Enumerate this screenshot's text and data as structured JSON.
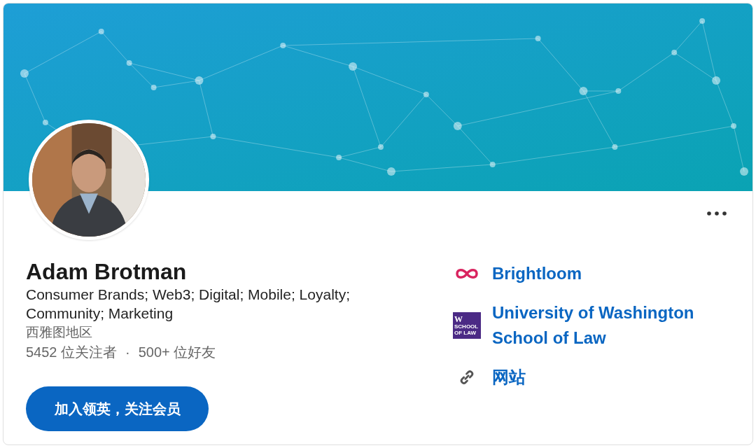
{
  "profile": {
    "name": "Adam Brotman",
    "headline": "Consumer Brands; Web3; Digital; Mobile; Loyalty; Community; Marketing",
    "location": "西雅图地区",
    "followers": "5452 位关注者",
    "separator": "·",
    "connections": "500+ 位好友"
  },
  "join_button": {
    "label": "加入领英，关注会员"
  },
  "links": [
    {
      "kind": "company",
      "label": "Brightloom"
    },
    {
      "kind": "school",
      "label": "University of Washington School of Law",
      "logo_letter": "W",
      "logo_text": "SCHOOL OF LAW"
    },
    {
      "kind": "website",
      "label": "网站"
    }
  ]
}
